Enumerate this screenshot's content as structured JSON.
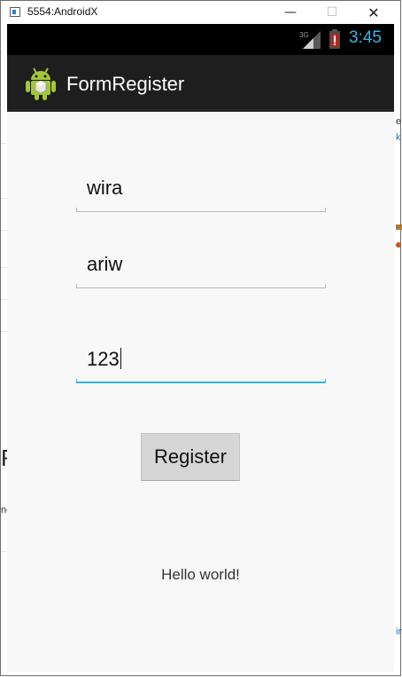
{
  "window": {
    "title": "5554:AndroidX",
    "minimize_glyph": "—",
    "maximize_glyph": "☐",
    "close_glyph": "✕"
  },
  "status_bar": {
    "network": "3G",
    "time": "3:45",
    "accent_color": "#33b5e5"
  },
  "action_bar": {
    "app_icon": "android-robot-icon",
    "title": "FormRegister"
  },
  "form": {
    "fields": [
      {
        "value": "wira"
      },
      {
        "value": "ariw"
      },
      {
        "value": "123"
      }
    ],
    "register_label": "Register"
  },
  "message": "Hello world!",
  "background_window": {
    "right_edge_text": [
      "e",
      "k",
      "in"
    ],
    "left_edge_text": [
      "R",
      "ne"
    ]
  }
}
